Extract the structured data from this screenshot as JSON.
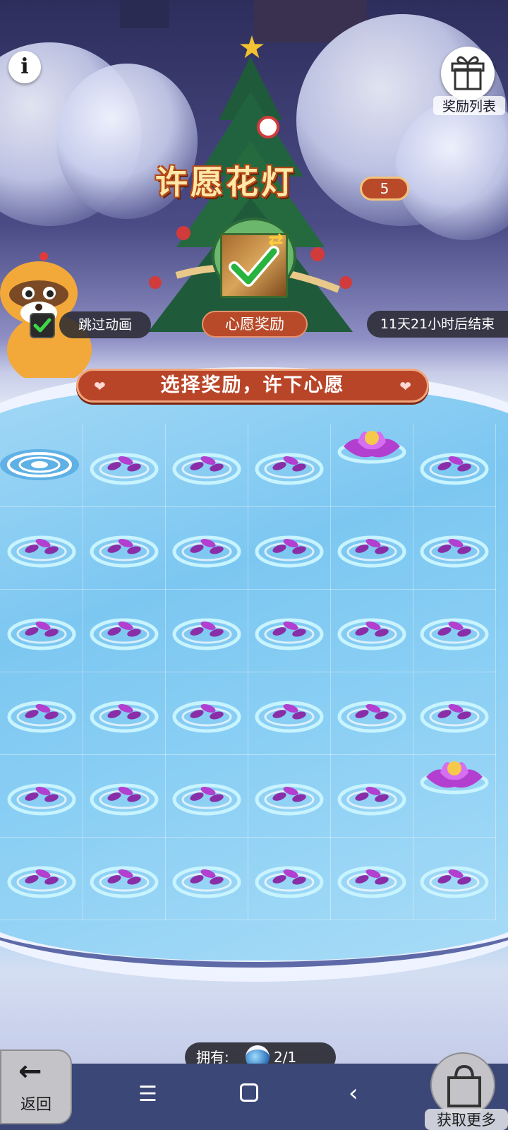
{
  "header": {
    "title": "许愿花灯",
    "title_count": "5",
    "reward_list_label": "奖励列表"
  },
  "wish": {
    "label": "心愿奖励",
    "selected": true
  },
  "controls": {
    "skip_animation_label": "跳过动画",
    "skip_animation_checked": true,
    "end_time": "11天21小时后结束"
  },
  "banner": {
    "text": "选择奖励，许下心愿"
  },
  "grid": {
    "rows": 6,
    "cols": 6,
    "cells": [
      [
        "whirlpool",
        "petal",
        "petal",
        "petal",
        "lotus",
        "petal"
      ],
      [
        "petal",
        "petal",
        "petal",
        "petal",
        "petal",
        "petal"
      ],
      [
        "petal",
        "petal",
        "petal",
        "petal",
        "petal",
        "petal"
      ],
      [
        "petal",
        "petal",
        "petal",
        "petal",
        "petal",
        "petal"
      ],
      [
        "petal",
        "petal",
        "petal",
        "petal",
        "petal",
        "lotus"
      ],
      [
        "petal",
        "petal",
        "petal",
        "petal",
        "petal",
        "petal"
      ]
    ]
  },
  "owned": {
    "label": "拥有:",
    "value": "2/1",
    "icon": "lantern-ball-icon"
  },
  "footer": {
    "back_label": "返回",
    "more_label": "获取更多"
  },
  "colors": {
    "accent": "#b94529",
    "pool": "#8bcff4",
    "lotus": "#b23fd0"
  }
}
